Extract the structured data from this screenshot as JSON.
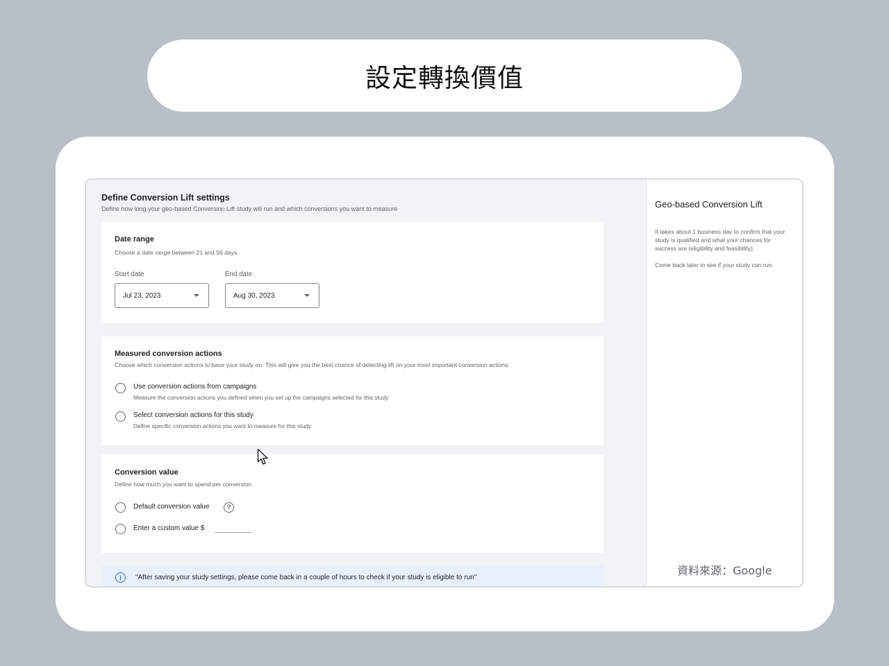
{
  "banner": {
    "title": "設定轉換價值"
  },
  "main": {
    "title": "Define Conversion Lift settings",
    "subtitle": "Define how long your geo-based Conversion Lift study will run and which conversions you want to measure",
    "date_range": {
      "title": "Date range",
      "subtitle": "Choose a date range between 21 and 56 days",
      "start_label": "Start date",
      "start_value": "Jul 23, 2023",
      "end_label": "End date",
      "end_value": "Aug 30, 2023"
    },
    "measured": {
      "title": "Measured conversion actions",
      "subtitle": "Choose which conversion actions to base your study on. This will give you the best chance of detecting lift on your most important conversion actions.",
      "options": [
        {
          "title": "Use conversion actions from campaigns",
          "subtitle": "Measure the conversion actions you defined when you set up the campaigns selected for this study"
        },
        {
          "title": "Select conversion actions for this study",
          "subtitle": "Define specific conversion actions you want to measure for this study"
        }
      ]
    },
    "conversion_value": {
      "title": "Conversion value",
      "subtitle": "Define how much you want to spend per conversion",
      "default_label": "Default conversion value",
      "custom_label": "Enter a custom value $"
    },
    "info": "\"After saving your study settings, please come back in a couple of hours to check if your study is eligible to run\""
  },
  "side": {
    "title": "Geo-based Conversion Lift",
    "para1": "It takes about 1 business day to confirm that your study is qualified and what your chances for success are (eligibility and feasibility).",
    "para2": "Come back later to see if your study can run.",
    "source": "資料來源：Google"
  },
  "icons": {
    "help": "question-circle-icon",
    "info": "info-icon",
    "cursor": "mouse-pointer-icon",
    "dropdown": "caret-down-icon"
  },
  "colors": {
    "backdrop": "#b9bfc7",
    "info_bg": "#e8f0fe",
    "info_accent": "#1a73e8"
  }
}
